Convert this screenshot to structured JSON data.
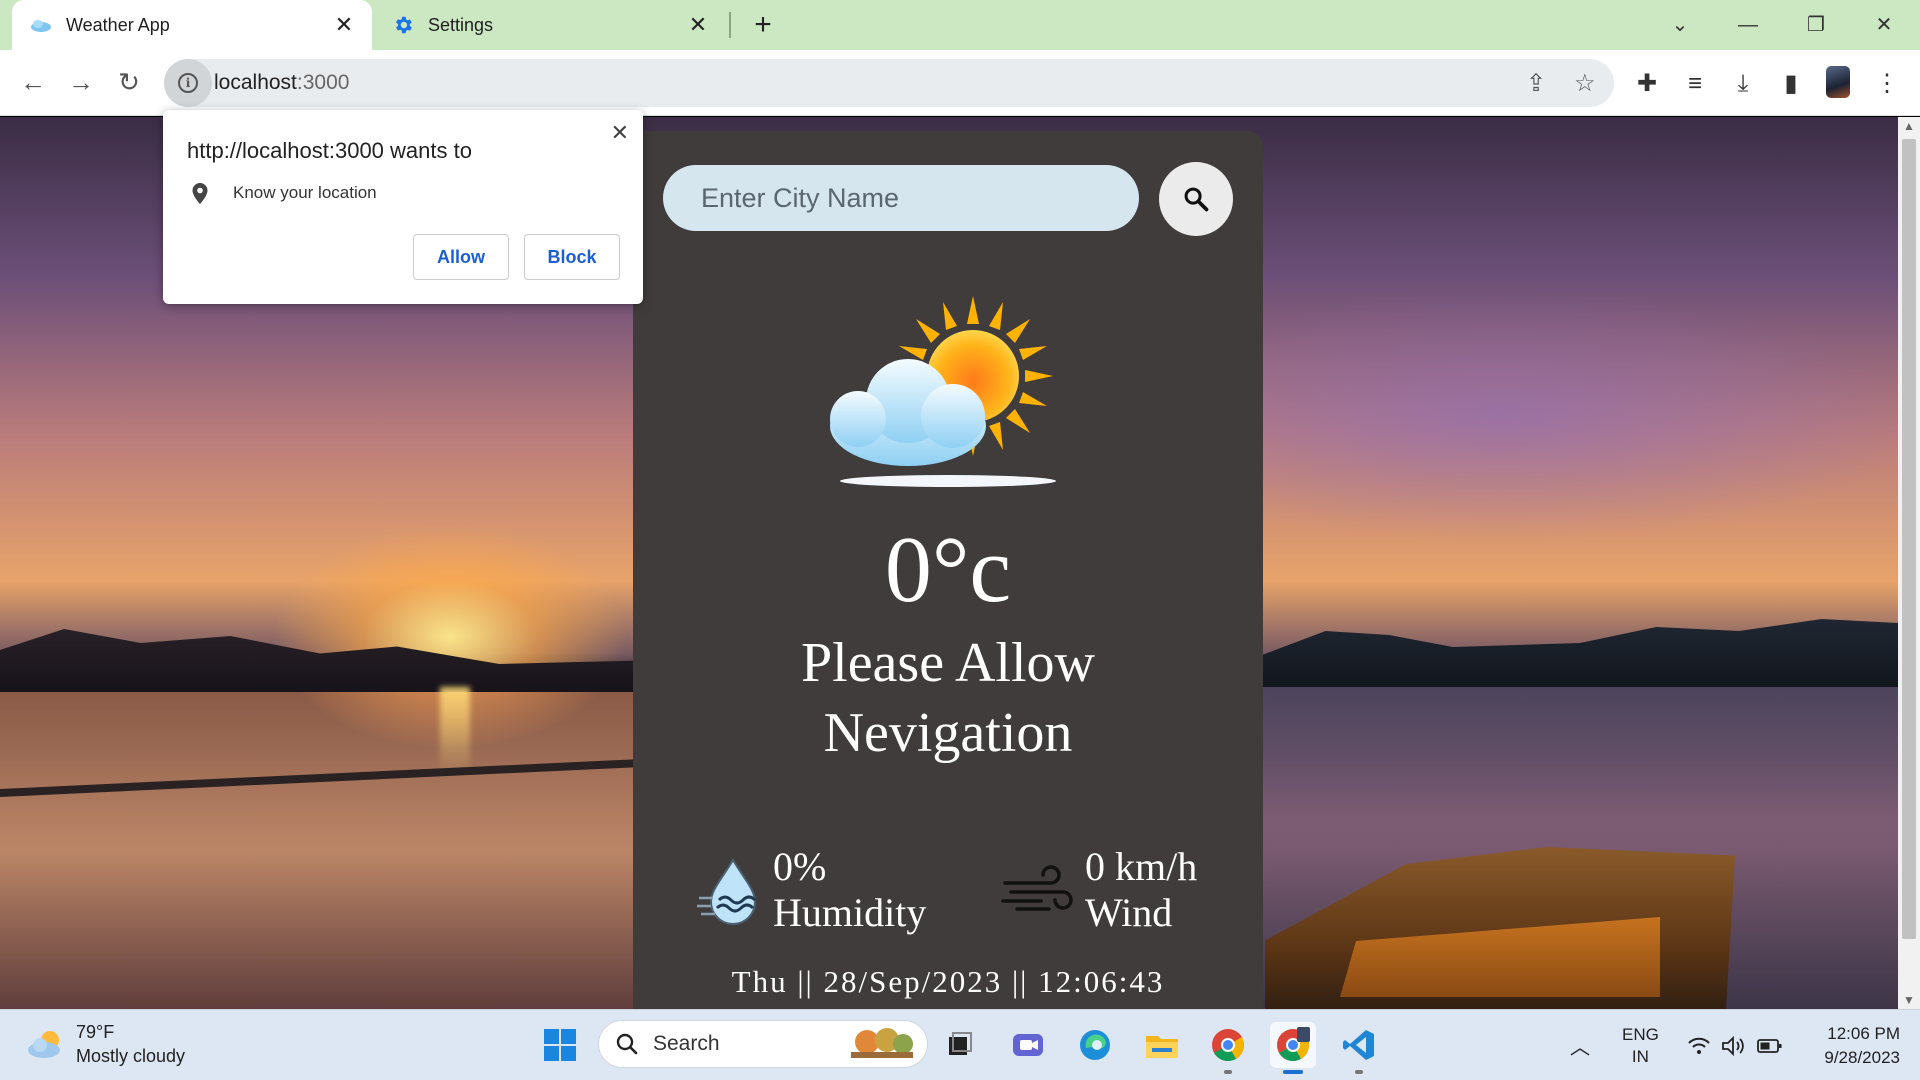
{
  "browser": {
    "tabs": [
      {
        "title": "Weather App",
        "icon": "cloud-favicon-icon"
      },
      {
        "title": "Settings",
        "icon": "gear-icon"
      }
    ],
    "url_host": "localhost",
    "url_port": ":3000"
  },
  "permission": {
    "title": "http://localhost:3000 wants to",
    "item": "Know your location",
    "allow": "Allow",
    "block": "Block"
  },
  "weather": {
    "search_placeholder": "Enter City Name",
    "temperature": "0°c",
    "status": "Please Allow Nevigation",
    "humidity_value": "0%",
    "humidity_label": "Humidity",
    "wind_value": "0 km/h",
    "wind_label": "Wind",
    "datetime": "Thu || 28/Sep/2023 || 12:06:43"
  },
  "taskbar": {
    "weather_temp": "79°F",
    "weather_desc": "Mostly cloudy",
    "search_label": "Search",
    "lang_line1": "ENG",
    "lang_line2": "IN",
    "time": "12:06 PM",
    "date": "9/28/2023"
  },
  "colors": {
    "tabstrip": "#cce8c3",
    "card_bg": "#403c3c",
    "input_bg": "#d6e6ef",
    "accent_blue": "#1a5fd4"
  }
}
